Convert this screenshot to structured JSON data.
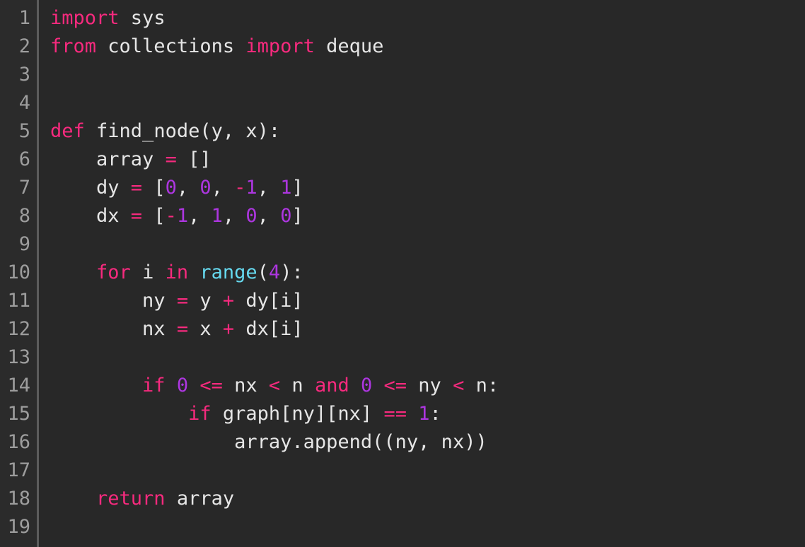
{
  "editor": {
    "name": "code-editor",
    "language": "python",
    "theme_colors": {
      "background": "#282828",
      "gutter_background": "#2b2b2b",
      "gutter_separator": "#5c5c5c",
      "line_number": "#9d9d9d",
      "plain_text": "#e6e6e6",
      "keyword": "#f72a7e",
      "operator": "#f72a7e",
      "number": "#ad36e0",
      "builtin": "#66d9ef"
    },
    "first_visible_line": 1,
    "last_visible_line": 19,
    "total_visible_lines": 19,
    "font_size_px": 27,
    "line_height_px": 40
  },
  "gutter": {
    "line_numbers": [
      "1",
      "2",
      "3",
      "4",
      "5",
      "6",
      "7",
      "8",
      "9",
      "10",
      "11",
      "12",
      "13",
      "14",
      "15",
      "16",
      "17",
      "18",
      "19"
    ]
  },
  "code": {
    "plain_text": "import sys\nfrom collections import deque\n\n\ndef find_node(y, x):\n    array = []\n    dy = [0, 0, -1, 1]\n    dx = [-1, 1, 0, 0]\n\n    for i in range(4):\n        ny = y + dy[i]\n        nx = x + dx[i]\n\n        if 0 <= nx < n and 0 <= ny < n:\n            if graph[ny][nx] == 1:\n                array.append((ny, nx))\n\n    return array\n",
    "lines": [
      {
        "number": "1",
        "tokens": [
          {
            "t": "import",
            "k": "keyword"
          },
          {
            "t": " sys",
            "k": "plain"
          }
        ]
      },
      {
        "number": "2",
        "tokens": [
          {
            "t": "from",
            "k": "keyword"
          },
          {
            "t": " collections ",
            "k": "plain"
          },
          {
            "t": "import",
            "k": "keyword"
          },
          {
            "t": " deque",
            "k": "plain"
          }
        ]
      },
      {
        "number": "3",
        "tokens": []
      },
      {
        "number": "4",
        "tokens": []
      },
      {
        "number": "5",
        "tokens": [
          {
            "t": "def",
            "k": "keyword"
          },
          {
            "t": " find_node(y, x):",
            "k": "plain"
          }
        ]
      },
      {
        "number": "6",
        "tokens": [
          {
            "t": "    array ",
            "k": "plain"
          },
          {
            "t": "=",
            "k": "operator"
          },
          {
            "t": " []",
            "k": "plain"
          }
        ]
      },
      {
        "number": "7",
        "tokens": [
          {
            "t": "    dy ",
            "k": "plain"
          },
          {
            "t": "=",
            "k": "operator"
          },
          {
            "t": " [",
            "k": "plain"
          },
          {
            "t": "0",
            "k": "number"
          },
          {
            "t": ", ",
            "k": "plain"
          },
          {
            "t": "0",
            "k": "number"
          },
          {
            "t": ", ",
            "k": "plain"
          },
          {
            "t": "-",
            "k": "operator"
          },
          {
            "t": "1",
            "k": "number"
          },
          {
            "t": ", ",
            "k": "plain"
          },
          {
            "t": "1",
            "k": "number"
          },
          {
            "t": "]",
            "k": "plain"
          }
        ]
      },
      {
        "number": "8",
        "tokens": [
          {
            "t": "    dx ",
            "k": "plain"
          },
          {
            "t": "=",
            "k": "operator"
          },
          {
            "t": " [",
            "k": "plain"
          },
          {
            "t": "-",
            "k": "operator"
          },
          {
            "t": "1",
            "k": "number"
          },
          {
            "t": ", ",
            "k": "plain"
          },
          {
            "t": "1",
            "k": "number"
          },
          {
            "t": ", ",
            "k": "plain"
          },
          {
            "t": "0",
            "k": "number"
          },
          {
            "t": ", ",
            "k": "plain"
          },
          {
            "t": "0",
            "k": "number"
          },
          {
            "t": "]",
            "k": "plain"
          }
        ]
      },
      {
        "number": "9",
        "tokens": []
      },
      {
        "number": "10",
        "tokens": [
          {
            "t": "    ",
            "k": "plain"
          },
          {
            "t": "for",
            "k": "keyword"
          },
          {
            "t": " i ",
            "k": "plain"
          },
          {
            "t": "in",
            "k": "keyword"
          },
          {
            "t": " ",
            "k": "plain"
          },
          {
            "t": "range",
            "k": "builtin"
          },
          {
            "t": "(",
            "k": "plain"
          },
          {
            "t": "4",
            "k": "number"
          },
          {
            "t": "):",
            "k": "plain"
          }
        ]
      },
      {
        "number": "11",
        "tokens": [
          {
            "t": "        ny ",
            "k": "plain"
          },
          {
            "t": "=",
            "k": "operator"
          },
          {
            "t": " y ",
            "k": "plain"
          },
          {
            "t": "+",
            "k": "operator"
          },
          {
            "t": " dy[i]",
            "k": "plain"
          }
        ]
      },
      {
        "number": "12",
        "tokens": [
          {
            "t": "        nx ",
            "k": "plain"
          },
          {
            "t": "=",
            "k": "operator"
          },
          {
            "t": " x ",
            "k": "plain"
          },
          {
            "t": "+",
            "k": "operator"
          },
          {
            "t": " dx[i]",
            "k": "plain"
          }
        ]
      },
      {
        "number": "13",
        "tokens": []
      },
      {
        "number": "14",
        "tokens": [
          {
            "t": "        ",
            "k": "plain"
          },
          {
            "t": "if",
            "k": "keyword"
          },
          {
            "t": " ",
            "k": "plain"
          },
          {
            "t": "0",
            "k": "number"
          },
          {
            "t": " ",
            "k": "plain"
          },
          {
            "t": "<=",
            "k": "operator"
          },
          {
            "t": " nx ",
            "k": "plain"
          },
          {
            "t": "<",
            "k": "operator"
          },
          {
            "t": " n ",
            "k": "plain"
          },
          {
            "t": "and",
            "k": "keyword"
          },
          {
            "t": " ",
            "k": "plain"
          },
          {
            "t": "0",
            "k": "number"
          },
          {
            "t": " ",
            "k": "plain"
          },
          {
            "t": "<=",
            "k": "operator"
          },
          {
            "t": " ny ",
            "k": "plain"
          },
          {
            "t": "<",
            "k": "operator"
          },
          {
            "t": " n:",
            "k": "plain"
          }
        ]
      },
      {
        "number": "15",
        "tokens": [
          {
            "t": "            ",
            "k": "plain"
          },
          {
            "t": "if",
            "k": "keyword"
          },
          {
            "t": " graph[ny][nx] ",
            "k": "plain"
          },
          {
            "t": "==",
            "k": "operator"
          },
          {
            "t": " ",
            "k": "plain"
          },
          {
            "t": "1",
            "k": "number"
          },
          {
            "t": ":",
            "k": "plain"
          }
        ]
      },
      {
        "number": "16",
        "tokens": [
          {
            "t": "                array.append((ny, nx))",
            "k": "plain"
          }
        ]
      },
      {
        "number": "17",
        "tokens": []
      },
      {
        "number": "18",
        "tokens": [
          {
            "t": "    ",
            "k": "plain"
          },
          {
            "t": "return",
            "k": "keyword"
          },
          {
            "t": " array",
            "k": "plain"
          }
        ]
      },
      {
        "number": "19",
        "tokens": []
      }
    ]
  }
}
